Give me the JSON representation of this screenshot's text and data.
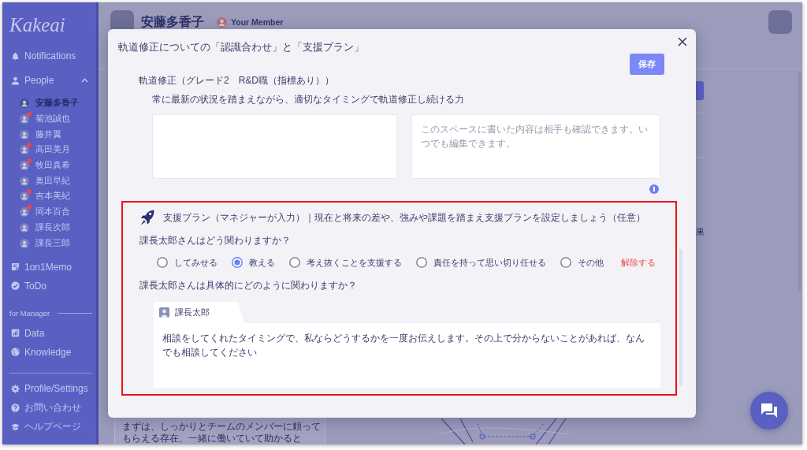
{
  "sidebar": {
    "logo": "Kakeai",
    "notifications": "Notifications",
    "people": {
      "label": "People",
      "expanded": true,
      "members": [
        {
          "name": "安藤多香子",
          "selected": true,
          "notification": false
        },
        {
          "name": "菊池誠也",
          "selected": false,
          "notification": true
        },
        {
          "name": "藤井翼",
          "selected": false,
          "notification": false
        },
        {
          "name": "高田美月",
          "selected": false,
          "notification": true
        },
        {
          "name": "牧田真希",
          "selected": false,
          "notification": true
        },
        {
          "name": "奥田早紀",
          "selected": false,
          "notification": false
        },
        {
          "name": "吉本美紀",
          "selected": false,
          "notification": true
        },
        {
          "name": "岡本百合",
          "selected": false,
          "notification": true
        },
        {
          "name": "課長次郎",
          "selected": false,
          "notification": false
        },
        {
          "name": "課長三郎",
          "selected": false,
          "notification": false
        }
      ]
    },
    "memo_items": [
      "1on1Memo",
      "ToDo"
    ],
    "manager_heading": "for Manager",
    "manager_items": [
      "Data",
      "Knowledge"
    ],
    "footer_items": [
      "Profile/Settings",
      "お問い合わせ",
      "ヘルプページ"
    ]
  },
  "header": {
    "name": "安藤多香子",
    "role": "Your Member"
  },
  "background": {
    "fragment_text": "果",
    "card_text": "まずは、しっかりとチームのメンバーに頼ってもらえる存在、一緒に働いていて助かると"
  },
  "modal": {
    "title": "軌道修正についての「認識合わせ」と「支援プラン」",
    "save": "保存",
    "competency": "軌道修正（グレード2　R&D職（指標あり））",
    "description": "常に最新の状況を踏まえながら、適切なタイミングで軌道修正し続ける力",
    "shared_note": {
      "placeholder": "このスペースに書いた内容は相手も確認できます。いつでも編集できます。"
    },
    "support_plan": {
      "heading": "支援プラン（マネジャーが入力）｜現在と将来の差や、強みや課題を踏まえ支援プランを設定しましょう（任意）",
      "question": "課長太郎さんはどう関わりますか？",
      "options": [
        {
          "label": "してみせる",
          "selected": false
        },
        {
          "label": "教える",
          "selected": true
        },
        {
          "label": "考え抜くことを支援する",
          "selected": false
        },
        {
          "label": "責任を持って思い切り任せる",
          "selected": false
        },
        {
          "label": "その他",
          "selected": false
        }
      ],
      "clear": "解除する",
      "detail_question": "課長太郎さんは具体的にどのように関わりますか？",
      "author": "課長太郎",
      "answer": "相談をしてくれたタイミングで、私ならどうするかを一度お伝えします。その上で分からないことがあれば、なんでも相談してください"
    }
  }
}
